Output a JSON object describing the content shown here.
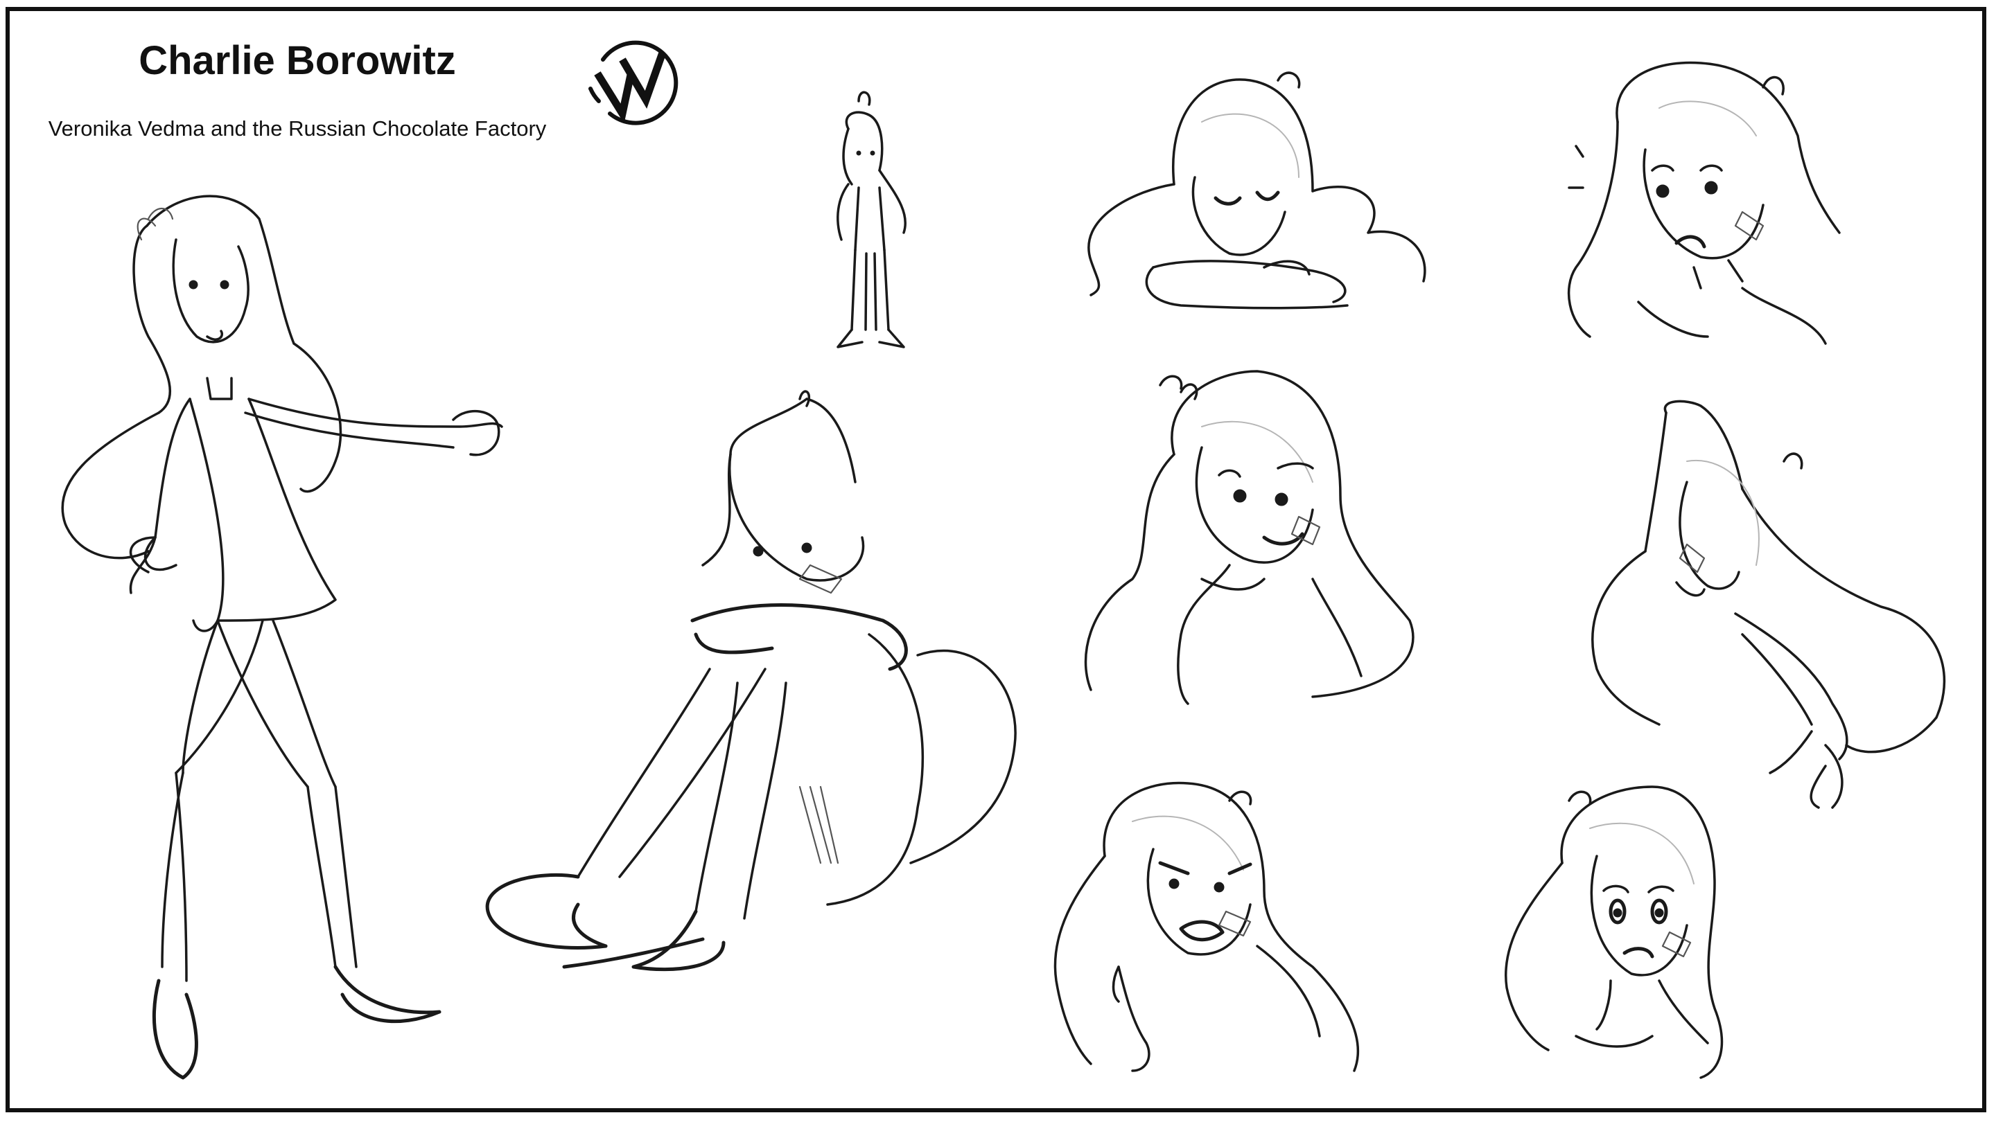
{
  "sheet": {
    "title": "Charlie Borowitz",
    "subtitle": "Veronika Vedma and the Russian Chocolate Factory",
    "logo_letters": "VV",
    "stroke_color": "#1a1a1a",
    "background_color": "#ffffff",
    "border_color": "#111111"
  },
  "drawings": [
    {
      "name": "full-body-pointing-pose"
    },
    {
      "name": "small-turnaround-pose"
    },
    {
      "name": "sitting-hugging-knees-pose"
    },
    {
      "name": "sleeping-on-arms-expression"
    },
    {
      "name": "startled-expression"
    },
    {
      "name": "shy-smile-expression"
    },
    {
      "name": "turning-away-reaching-pose"
    },
    {
      "name": "angry-pointing-expression"
    },
    {
      "name": "worried-expression"
    }
  ]
}
